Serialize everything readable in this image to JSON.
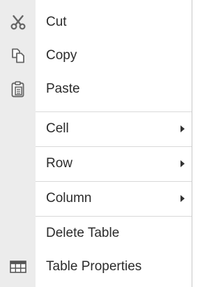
{
  "menu": {
    "items": [
      {
        "label": "Cut",
        "icon": "scissors-icon",
        "submenu": false
      },
      {
        "label": "Copy",
        "icon": "copy-icon",
        "submenu": false
      },
      {
        "label": "Paste",
        "icon": "clipboard-icon",
        "submenu": false
      },
      {
        "label": "Cell",
        "icon": "",
        "submenu": true
      },
      {
        "label": "Row",
        "icon": "",
        "submenu": true
      },
      {
        "label": "Column",
        "icon": "",
        "submenu": true
      },
      {
        "label": "Delete Table",
        "icon": "",
        "submenu": false
      },
      {
        "label": "Table Properties",
        "icon": "table-icon",
        "submenu": false
      }
    ]
  },
  "colors": {
    "gutter": "#ececec",
    "text": "#2b2b2b",
    "icon": "#666666",
    "separator": "#d9d9d9"
  }
}
